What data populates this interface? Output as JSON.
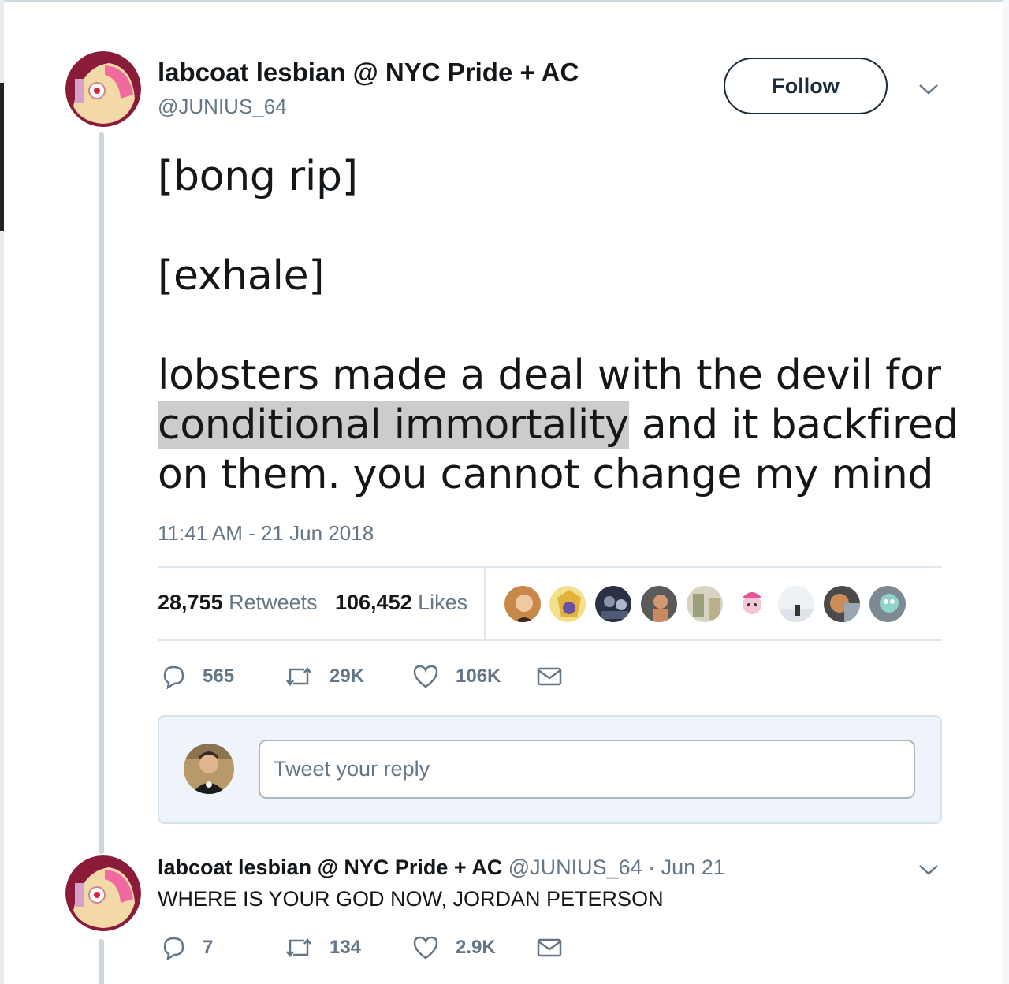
{
  "tweet": {
    "author_name": "labcoat lesbian @ NYC Pride + AC",
    "author_handle": "@JUNIUS_64",
    "follow_label": "Follow",
    "text_line1": "[bong rip]",
    "text_line2": "[exhale]",
    "text_line3": "lobsters made a deal with the devil for",
    "text_line4_highlighted": "conditional immortality",
    "text_line4_rest": " and it backfired",
    "text_line5": "on them. you cannot change my mind",
    "timestamp": "11:41 AM - 21 Jun 2018",
    "retweets_count": "28,755",
    "retweets_label": "Retweets",
    "likes_count": "106,452",
    "likes_label": "Likes",
    "actions": {
      "replies": "565",
      "retweets": "29K",
      "likes": "106K"
    }
  },
  "reply_composer": {
    "placeholder": "Tweet your reply"
  },
  "reply": {
    "author_name": "labcoat lesbian @ NYC Pride + AC",
    "meta": "@JUNIUS_64 · Jun 21",
    "text": "WHERE IS YOUR GOD NOW, JORDAN PETERSON",
    "actions": {
      "replies": "7",
      "retweets": "134",
      "likes": "2.9K"
    }
  },
  "colors": {
    "text": "#14171a",
    "muted": "#657786",
    "border": "#e1e8ed",
    "highlight": "#cccccc"
  }
}
